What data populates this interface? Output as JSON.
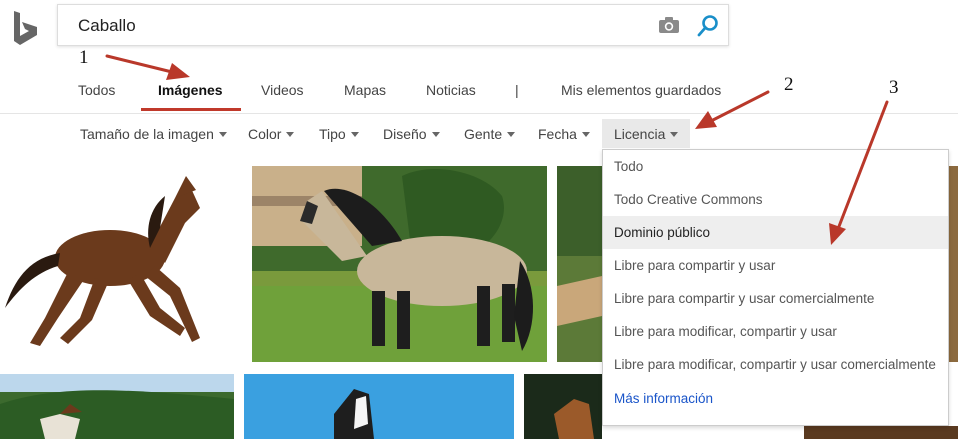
{
  "search": {
    "query": "Caballo"
  },
  "tabs": [
    {
      "label": "Todos"
    },
    {
      "label": "Imágenes"
    },
    {
      "label": "Videos"
    },
    {
      "label": "Mapas"
    },
    {
      "label": "Noticias"
    },
    {
      "label": "|"
    },
    {
      "label": "Mis elementos guardados"
    }
  ],
  "filters": [
    {
      "label": "Tamaño de la imagen"
    },
    {
      "label": "Color"
    },
    {
      "label": "Tipo"
    },
    {
      "label": "Diseño"
    },
    {
      "label": "Gente"
    },
    {
      "label": "Fecha"
    },
    {
      "label": "Licencia"
    }
  ],
  "license_menu": {
    "items": [
      "Todo",
      "Todo Creative Commons",
      "Dominio público",
      "Libre para compartir y usar",
      "Libre para compartir y usar comercialmente",
      "Libre para modificar, compartir y usar",
      "Libre para modificar, compartir y usar comercialmente"
    ],
    "selected_index": 2,
    "more_link": "Más información"
  },
  "annotations": [
    "1",
    "2",
    "3"
  ],
  "colors": {
    "accent": "#c0392b",
    "link": "#1a55c9",
    "search_icon": "#1a8fc9",
    "arrow": "#b9382a"
  }
}
